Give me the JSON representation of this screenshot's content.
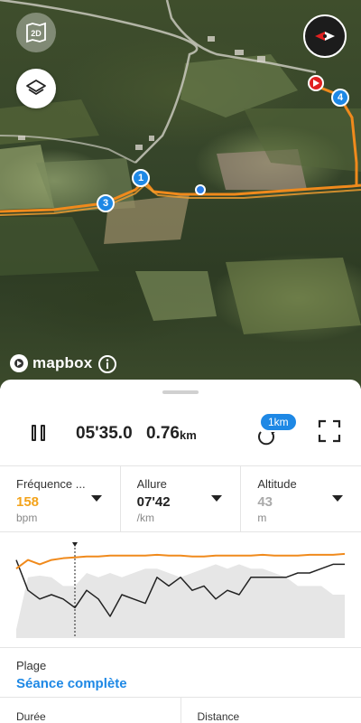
{
  "map": {
    "mode_toggle_label": "2D",
    "attribution": "mapbox",
    "markers": [
      "1",
      "3",
      "4"
    ],
    "colors": {
      "route": "#f08a1c",
      "marker": "#1e88e5",
      "start_marker": "#e02020"
    }
  },
  "controls": {
    "elapsed": "05'35.0",
    "distance": "0.76",
    "distance_unit": "km",
    "lap_badge": "1km"
  },
  "metrics": [
    {
      "label": "Fréquence ...",
      "value": "158",
      "unit": "bpm",
      "value_color": "#f3a31b"
    },
    {
      "label": "Allure",
      "value": "07'42",
      "unit": "/km",
      "value_color": "#222222"
    },
    {
      "label": "Altitude",
      "value": "43",
      "unit": "m",
      "value_color": "#aaaaaa"
    }
  ],
  "chart_data": {
    "type": "line",
    "series": [
      {
        "values": [
          0.8,
          0.9,
          0.85,
          0.9,
          0.92,
          0.93,
          0.94,
          0.94,
          0.95,
          0.95,
          0.95,
          0.95,
          0.96,
          0.95,
          0.95,
          0.94,
          0.94,
          0.95,
          0.95,
          0.95,
          0.95,
          0.96,
          0.95,
          0.95,
          0.95,
          0.96,
          0.96,
          0.96,
          0.97
        ]
      },
      {
        "values": [
          0.9,
          0.55,
          0.45,
          0.5,
          0.45,
          0.35,
          0.55,
          0.45,
          0.25,
          0.5,
          0.45,
          0.4,
          0.7,
          0.6,
          0.7,
          0.55,
          0.6,
          0.45,
          0.55,
          0.5,
          0.7,
          0.7,
          0.7,
          0.7,
          0.75,
          0.75,
          0.8,
          0.85,
          0.85
        ]
      },
      {
        "values": [
          0.1,
          0.7,
          0.72,
          0.7,
          0.6,
          0.6,
          0.75,
          0.7,
          0.75,
          0.7,
          0.75,
          0.8,
          0.8,
          0.75,
          0.7,
          0.75,
          0.8,
          0.85,
          0.8,
          0.85,
          0.8,
          0.8,
          0.75,
          0.7,
          0.6,
          0.6,
          0.6,
          0.5,
          0.5
        ]
      }
    ],
    "cursor_index": 5,
    "colors": [
      "#f08a1c",
      "#222222",
      "#cccccc"
    ]
  },
  "range": {
    "label": "Plage",
    "value": "Séance complète"
  },
  "summary": [
    {
      "label": "Durée"
    },
    {
      "label": "Distance"
    }
  ]
}
